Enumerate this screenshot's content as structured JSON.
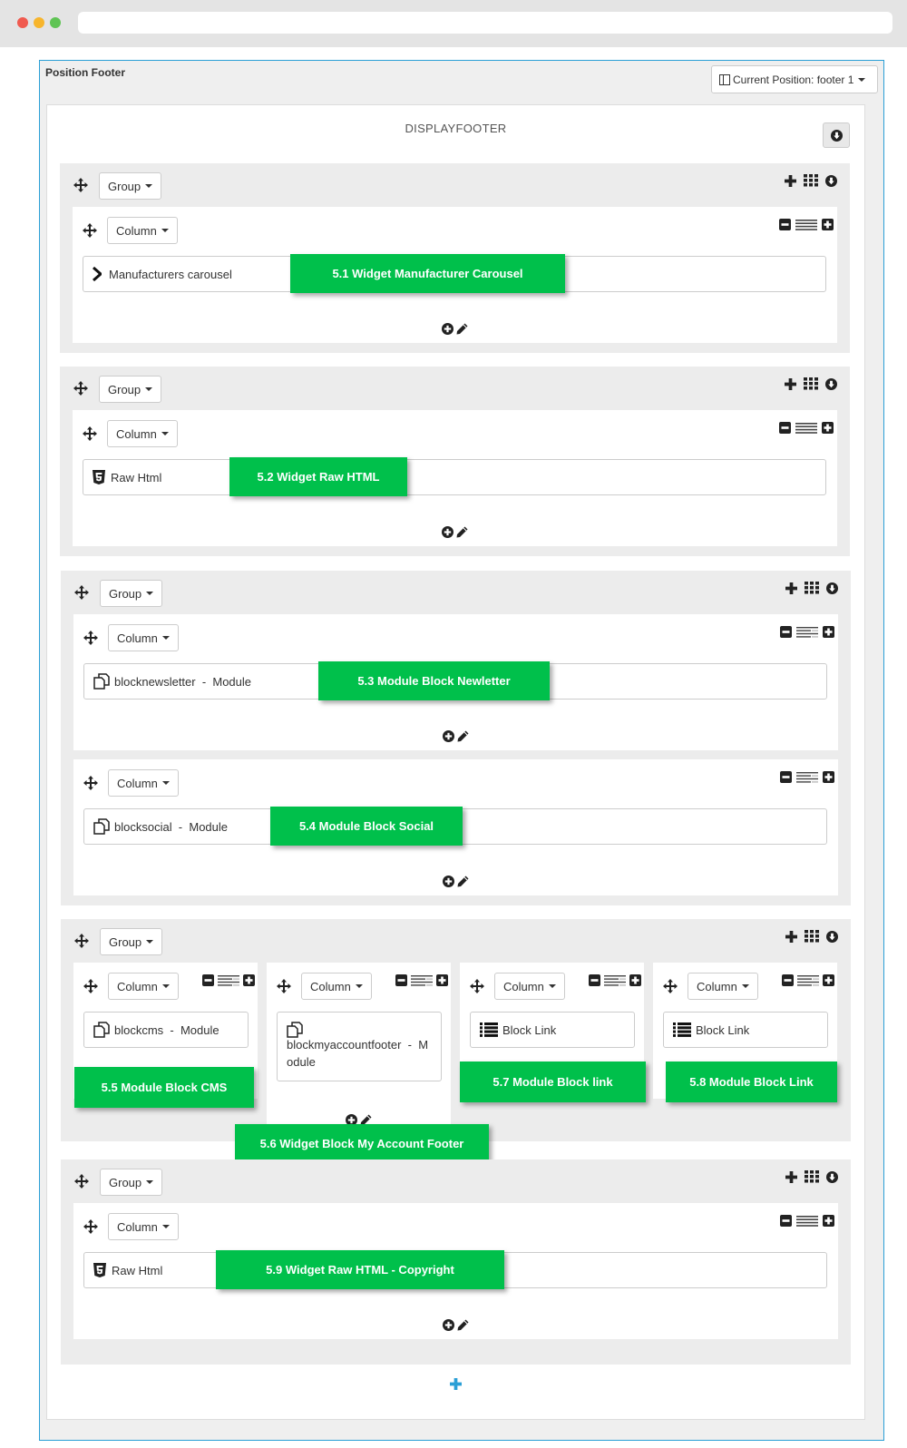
{
  "panel": {
    "title": "Position Footer",
    "position_label": "Current Position: footer 1"
  },
  "hook_title": "DISPLAYFOOTER",
  "labels": {
    "group": "Group",
    "column": "Column"
  },
  "groups": [
    {
      "widgets": [
        {
          "name": "Manufacturers carousel",
          "annotation": "5.1 Widget Manufacturer Carousel"
        }
      ]
    },
    {
      "widgets": [
        {
          "name": "Raw Html",
          "annotation": "5.2 Widget Raw HTML"
        }
      ]
    },
    {
      "widgets": [
        {
          "name": "blocknewsletter  -  Module",
          "annotation": "5.3 Module Block Newletter"
        },
        {
          "name": "blocksocial  -  Module",
          "annotation": "5.4 Module Block Social"
        }
      ]
    },
    {
      "widgets": [
        {
          "name": "blockcms  -  Module",
          "annotation": "5.5 Module Block CMS"
        },
        {
          "name": "blockmyaccountfooter  -  Module",
          "annotation": "5.6 Widget Block My Account Footer"
        },
        {
          "name": "Block Link",
          "annotation": "5.7 Module Block link"
        },
        {
          "name": "Block Link",
          "annotation": "5.8 Module Block Link"
        }
      ]
    },
    {
      "widgets": [
        {
          "name": "Raw Html",
          "annotation": "5.9 Widget Raw HTML - Copyright"
        }
      ]
    }
  ],
  "icons": [
    "move-icon",
    "plus-icon",
    "grid-icon",
    "download-circle-icon",
    "minus-square-icon",
    "list-icon",
    "plus-square-icon",
    "plus-circle-icon",
    "pencil-icon",
    "chevron-right-icon",
    "html5-icon",
    "module-copy-icon",
    "list-lines-icon"
  ],
  "colors": {
    "accent": "#2a9fd6",
    "annotation": "#00c04b"
  }
}
